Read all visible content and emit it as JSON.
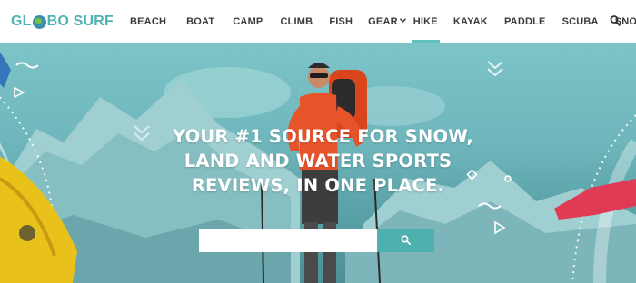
{
  "site": {
    "logo_text_left": "GL",
    "logo_text_right": "BO SURF",
    "logo_icon": "globe-icon"
  },
  "nav": {
    "items": [
      {
        "label": "BEACH"
      },
      {
        "label": "BOAT"
      },
      {
        "label": "CAMP"
      },
      {
        "label": "CLIMB"
      },
      {
        "label": "FISH"
      },
      {
        "label": "GEAR",
        "has_dropdown": true
      },
      {
        "label": "HIKE",
        "active": true
      },
      {
        "label": "KAYAK"
      },
      {
        "label": "PADDLE"
      },
      {
        "label": "SCUBA"
      },
      {
        "label": "SNORKEL"
      }
    ],
    "search_icon": "search-icon",
    "dropdown_icon": "chevron-down-icon"
  },
  "hero": {
    "headline_lines": [
      "YOUR #1 SOURCE FOR SNOW,",
      "LAND AND WATER SPORTS",
      "REVIEWS, IN ONE PLACE."
    ],
    "search_input_value": "",
    "search_button_icon": "search-icon"
  },
  "colors": {
    "accent": "#5cc1bf",
    "button": "#4fb1ad",
    "hero_tint": "#6fb7bc",
    "jacket": "#e8542a",
    "kayak": "#e8c21a"
  }
}
